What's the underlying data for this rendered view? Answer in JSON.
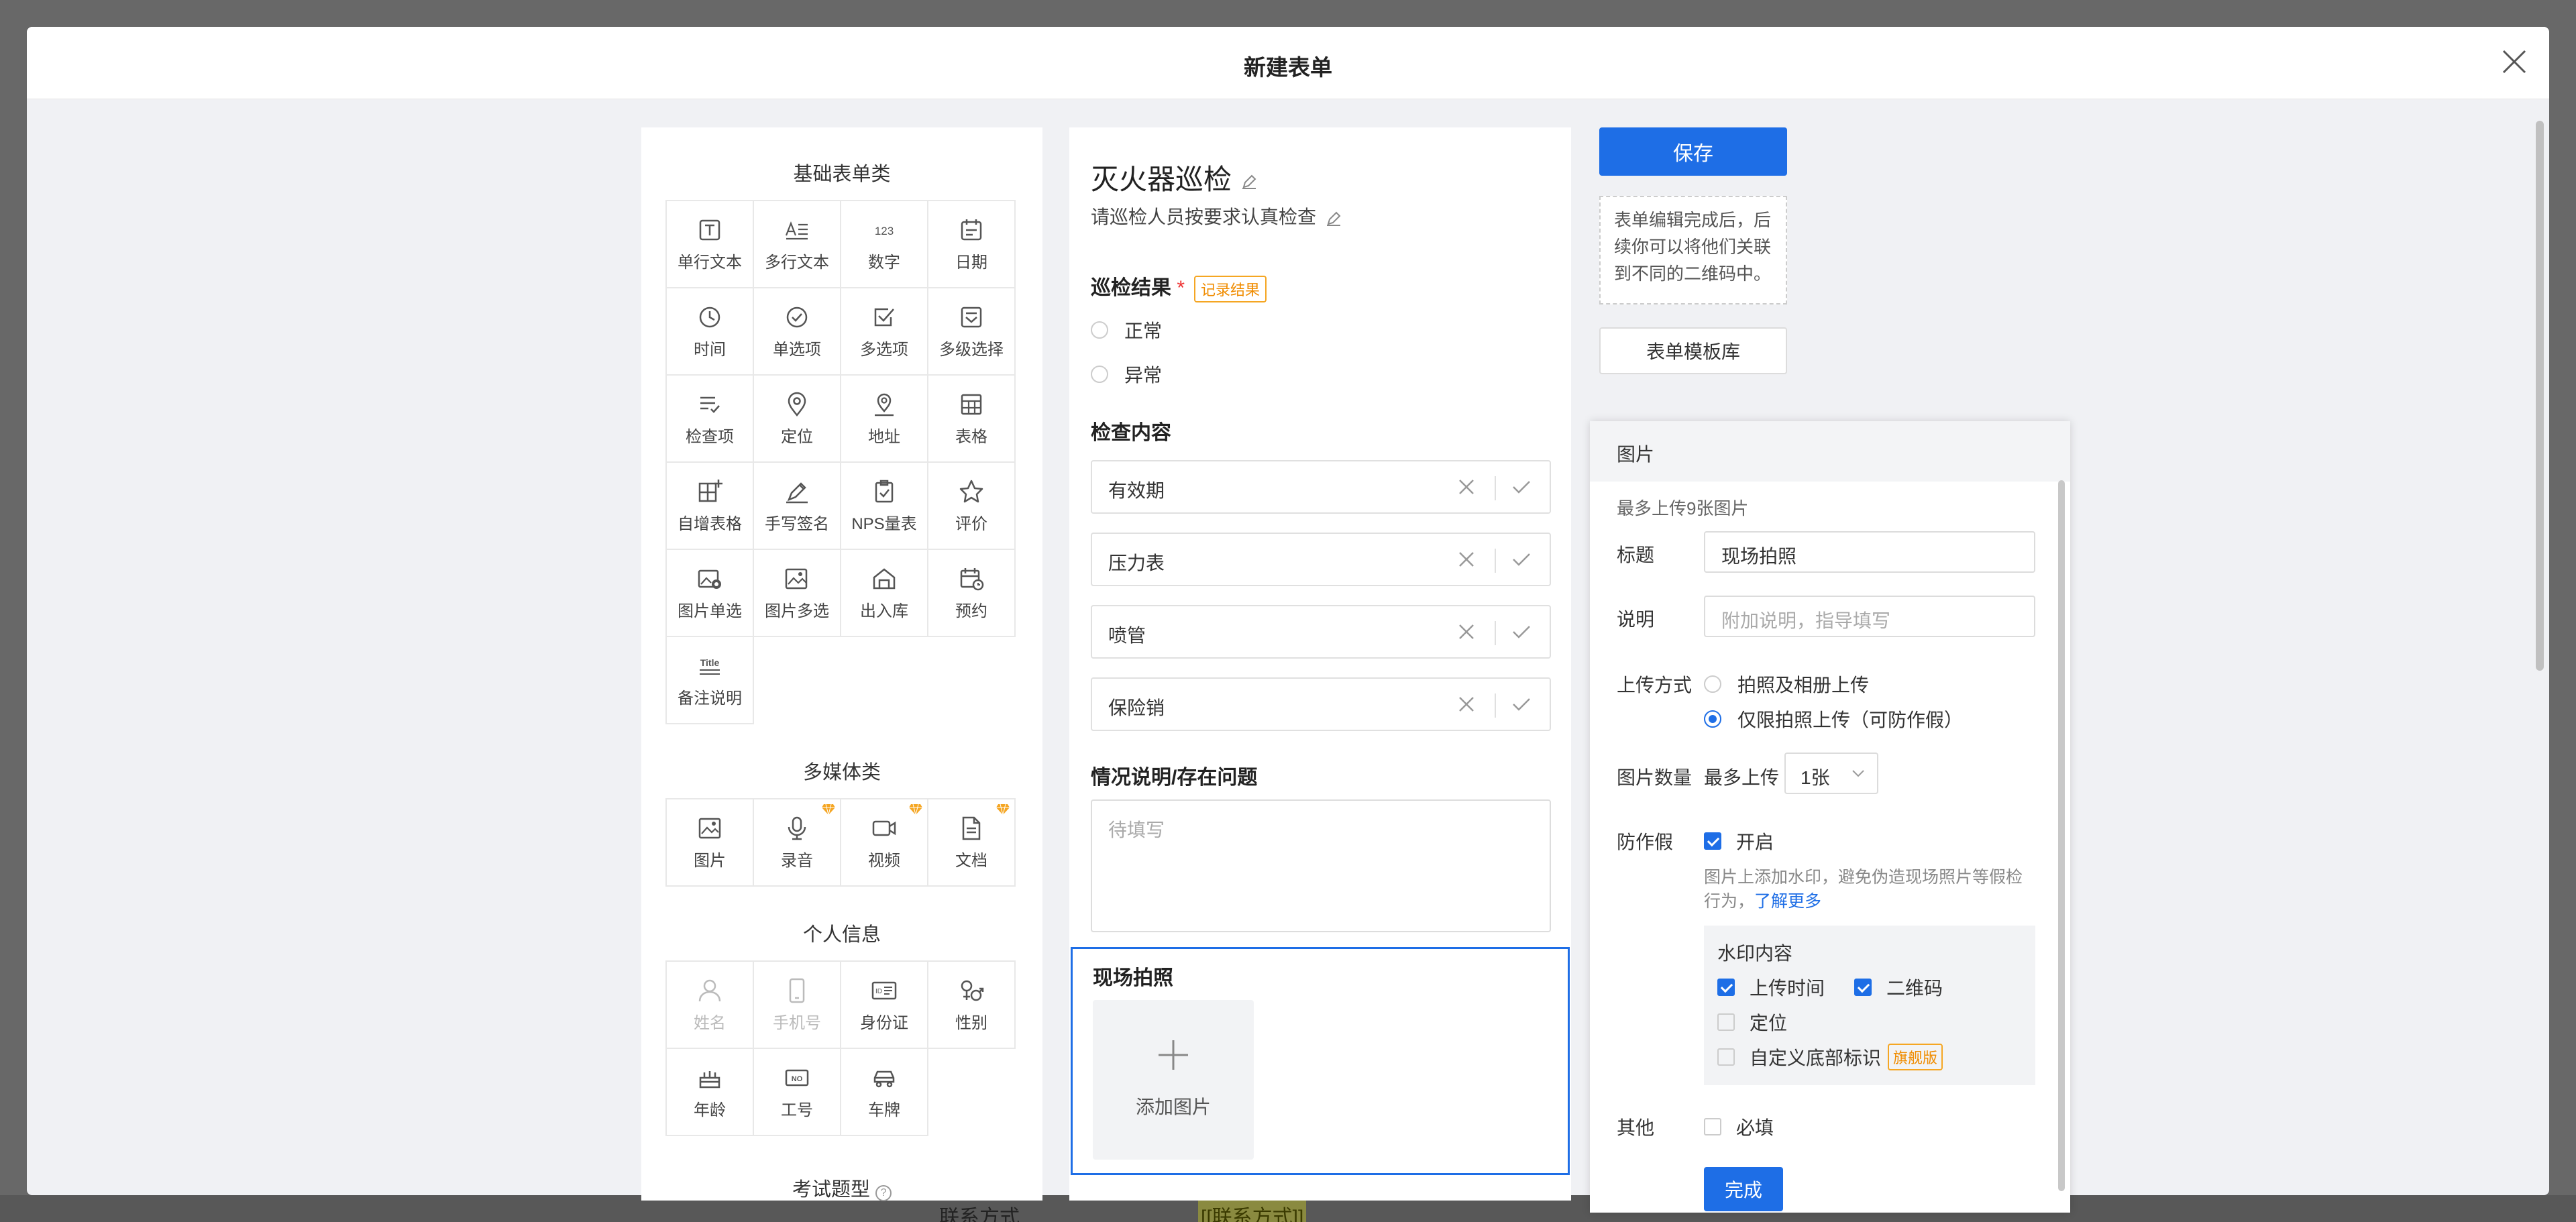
{
  "modal": {
    "title": "新建表单"
  },
  "left": {
    "basic_title": "基础表单类",
    "basic": [
      {
        "label": "单行文本",
        "icon": "single-line-text-icon"
      },
      {
        "label": "多行文本",
        "icon": "multi-line-text-icon"
      },
      {
        "label": "数字",
        "icon": "number-icon"
      },
      {
        "label": "日期",
        "icon": "calendar-icon"
      },
      {
        "label": "时间",
        "icon": "clock-icon"
      },
      {
        "label": "单选项",
        "icon": "radio-check-icon"
      },
      {
        "label": "多选项",
        "icon": "checkbox-icon"
      },
      {
        "label": "多级选择",
        "icon": "cascade-select-icon"
      },
      {
        "label": "检查项",
        "icon": "checklist-icon"
      },
      {
        "label": "定位",
        "icon": "location-pin-icon"
      },
      {
        "label": "地址",
        "icon": "address-icon"
      },
      {
        "label": "表格",
        "icon": "table-icon"
      },
      {
        "label": "自增表格",
        "icon": "add-table-icon"
      },
      {
        "label": "手写签名",
        "icon": "pen-signature-icon"
      },
      {
        "label": "NPS量表",
        "icon": "nps-clipboard-icon"
      },
      {
        "label": "评价",
        "icon": "star-icon"
      },
      {
        "label": "图片单选",
        "icon": "image-radio-icon"
      },
      {
        "label": "图片多选",
        "icon": "image-multi-icon"
      },
      {
        "label": "出入库",
        "icon": "warehouse-icon"
      },
      {
        "label": "预约",
        "icon": "appointment-icon"
      },
      {
        "label": "备注说明",
        "icon": "title-note-icon"
      }
    ],
    "media_title": "多媒体类",
    "media": [
      {
        "label": "图片",
        "icon": "image-icon",
        "premium": false
      },
      {
        "label": "录音",
        "icon": "microphone-icon",
        "premium": true
      },
      {
        "label": "视频",
        "icon": "video-icon",
        "premium": true
      },
      {
        "label": "文档",
        "icon": "document-icon",
        "premium": true
      }
    ],
    "personal_title": "个人信息",
    "personal": [
      {
        "label": "姓名",
        "icon": "person-icon",
        "disabled": true
      },
      {
        "label": "手机号",
        "icon": "phone-icon",
        "disabled": true
      },
      {
        "label": "身份证",
        "icon": "id-card-icon",
        "disabled": false
      },
      {
        "label": "性别",
        "icon": "gender-icon",
        "disabled": false
      },
      {
        "label": "年龄",
        "icon": "age-cake-icon",
        "disabled": false
      },
      {
        "label": "工号",
        "icon": "employee-no-icon",
        "disabled": false
      },
      {
        "label": "车牌",
        "icon": "car-icon",
        "disabled": false
      }
    ],
    "exam_title": "考试题型"
  },
  "form": {
    "title": "灭火器巡检",
    "desc": "请巡检人员按要求认真检查",
    "result_label": "巡检结果",
    "result_required": "*",
    "result_tag": "记录结果",
    "result_options": [
      "正常",
      "异常"
    ],
    "check_label": "检查内容",
    "check_items": [
      "有效期",
      "压力表",
      "喷管",
      "保险销"
    ],
    "issue_label": "情况说明/存在问题",
    "issue_placeholder": "待填写",
    "photo_label": "现场拍照",
    "photo_add": "添加图片"
  },
  "actions": {
    "save": "保存",
    "tip": "表单编辑完成后，后续你可以将他们关联到不同的二维码中。",
    "template": "表单模板库"
  },
  "panel": {
    "header": "图片",
    "limit_note": "最多上传9张图片",
    "title_label": "标题",
    "title_value": "现场拍照",
    "desc_label": "说明",
    "desc_placeholder": "附加说明，指导填写",
    "upload_label": "上传方式",
    "upload_options": [
      {
        "label": "拍照及相册上传",
        "selected": false
      },
      {
        "label": "仅限拍照上传（可防作假）",
        "selected": true
      }
    ],
    "count_label": "图片数量",
    "count_prefix": "最多上传",
    "count_value": "1张",
    "fake_label": "防作假",
    "fake_on_label": "开启",
    "fake_on": true,
    "fake_note": "图片上添加水印，避免伪造现场照片等假检行为，",
    "fake_link": "了解更多",
    "wm_title": "水印内容",
    "wm_time": "上传时间",
    "wm_time_on": true,
    "wm_qr": "二维码",
    "wm_qr_on": true,
    "wm_loc": "定位",
    "wm_loc_on": false,
    "wm_custom": "自定义底部标识",
    "wm_custom_tag": "旗舰版",
    "other_label": "其他",
    "required_label": "必填",
    "done": "完成"
  },
  "background": {
    "row_label": "联系方式",
    "row_value": "[[联系方式]]"
  },
  "colors": {
    "primary": "#1e6ee6",
    "warning": "#f5a623",
    "premium": "#f5a623"
  }
}
